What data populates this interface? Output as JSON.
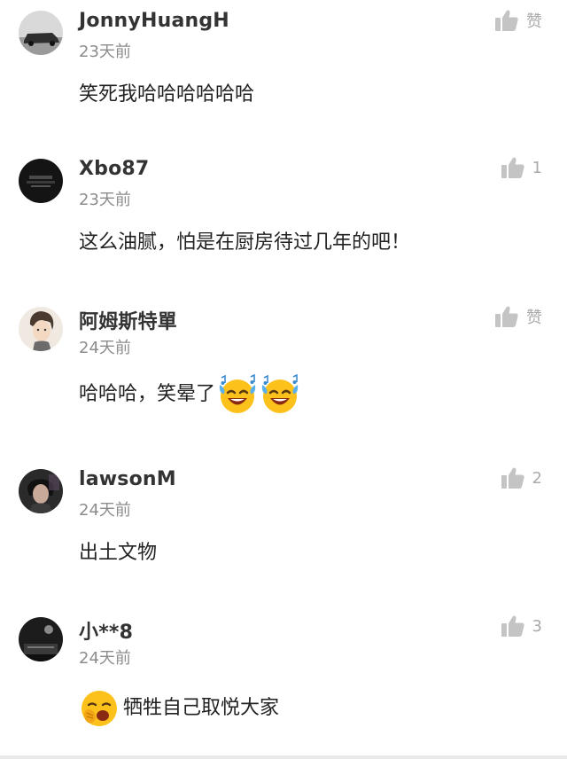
{
  "comments": [
    {
      "username": "JonnyHuangH",
      "time": "23天前",
      "content": "笑死我哈哈哈哈哈哈",
      "likes": "赞",
      "avatar": "car-photo"
    },
    {
      "username": "Xbo87",
      "time": "23天前",
      "content": "这么油腻，怕是在厨房待过几年的吧！",
      "likes": "1",
      "avatar": "dark-logo"
    },
    {
      "username": "阿姆斯特單",
      "time": "24天前",
      "content": "哈哈哈，笑晕了",
      "likes": "赞",
      "avatar": "anime-man",
      "emojis": [
        "laughing-tears-emoji",
        "laughing-tears-emoji"
      ]
    },
    {
      "username": "lawsonM",
      "time": "24天前",
      "content": "出土文物",
      "likes": "2",
      "avatar": "dark-portrait"
    },
    {
      "username": "小**8",
      "time": "24天前",
      "content": "牺牲自己取悦大家",
      "likes": "3",
      "avatar": "dark-scene",
      "lead_emoji": "yawning-face-emoji"
    }
  ],
  "colors": {
    "username": "#333333",
    "time": "#8c8c8c",
    "like_icon": "#c4c4c4",
    "like_text": "#aaaaaa"
  }
}
